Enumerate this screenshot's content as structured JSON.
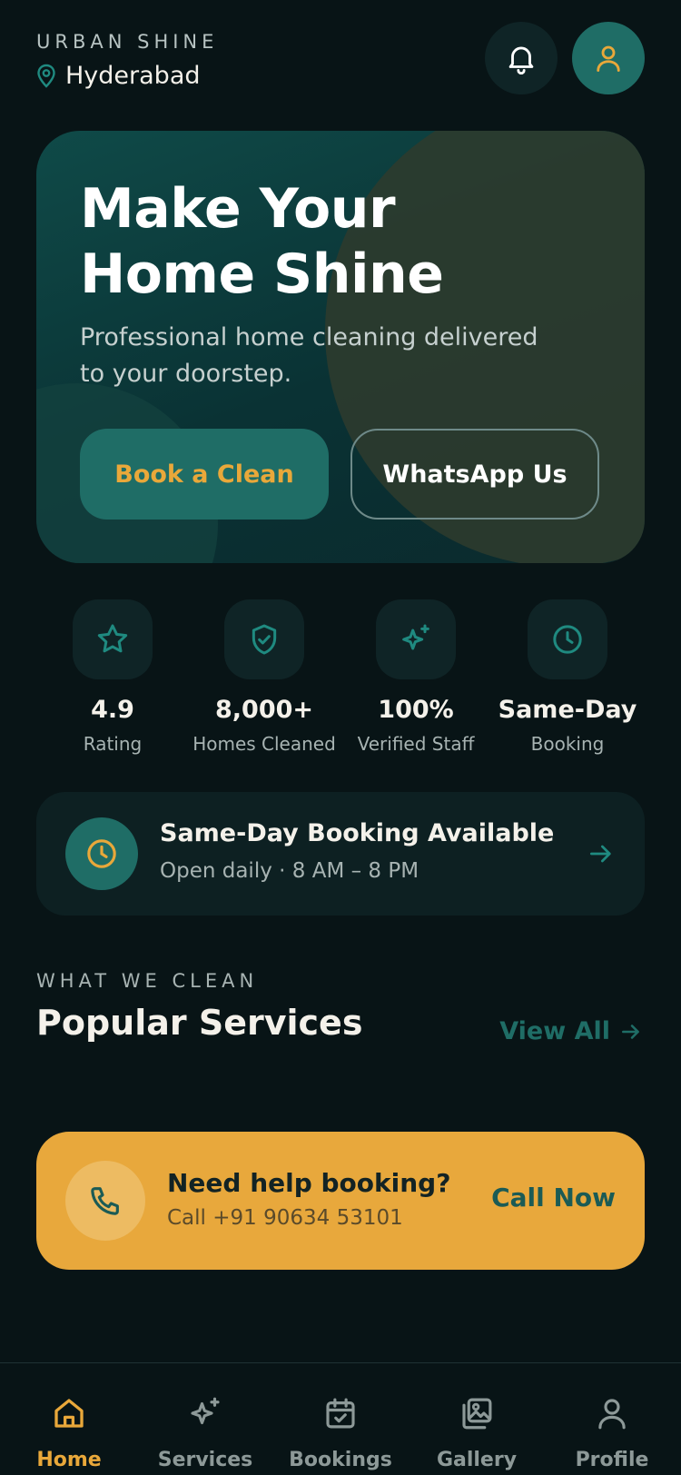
{
  "header": {
    "brand": "URBAN SHINE",
    "location": "Hyderabad",
    "location_icon": "map-pin-icon",
    "notification_icon": "bell-icon",
    "profile_icon": "user-icon"
  },
  "hero": {
    "title": "Make Your Home Shine",
    "subtitle": "Professional home cleaning delivered to your doorstep.",
    "primary_button": "Book a Clean",
    "secondary_button": "WhatsApp Us"
  },
  "stats": [
    {
      "icon": "star-icon",
      "value": "4.9",
      "label": "Rating"
    },
    {
      "icon": "shield-check-icon",
      "value": "8,000+",
      "label": "Homes Cleaned"
    },
    {
      "icon": "sparkle-icon",
      "value": "100%",
      "label": "Verified Staff"
    },
    {
      "icon": "clock-icon",
      "value": "Same-Day",
      "label": "Booking"
    }
  ],
  "same_day": {
    "title": "Same-Day Booking Available",
    "subtitle": "Open daily · 8 AM – 8 PM",
    "icon": "clock-icon"
  },
  "services": {
    "eyebrow": "WHAT WE CLEAN",
    "title": "Popular Services",
    "view_all": "View All"
  },
  "help": {
    "title": "Need help booking?",
    "subtitle": "Call +91 90634 53101",
    "cta": "Call Now",
    "icon": "phone-icon"
  },
  "nav": {
    "active": "Home",
    "items": [
      {
        "label": "Home",
        "icon": "home-icon"
      },
      {
        "label": "Services",
        "icon": "sparkle-icon"
      },
      {
        "label": "Bookings",
        "icon": "calendar-check-icon"
      },
      {
        "label": "Gallery",
        "icon": "gallery-icon"
      },
      {
        "label": "Profile",
        "icon": "user-icon"
      }
    ]
  },
  "colors": {
    "background": "#081416",
    "teal": "#1f6d66",
    "amber": "#e9a83a",
    "card": "#0d2022"
  }
}
